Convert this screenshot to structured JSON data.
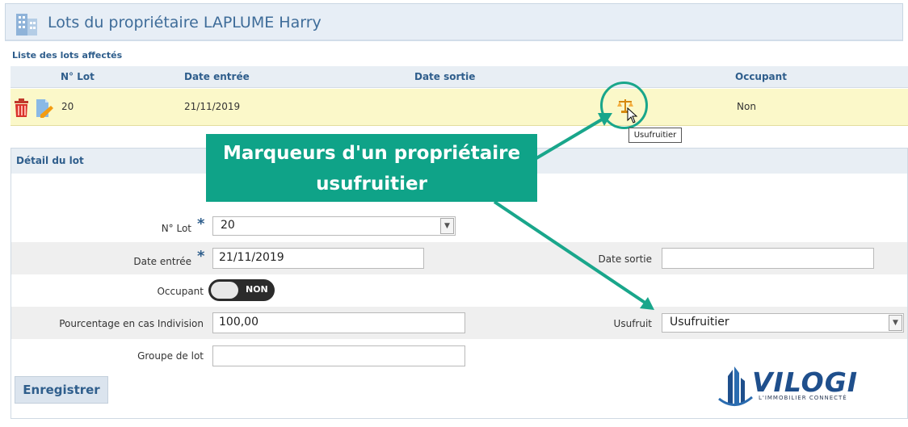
{
  "header": {
    "title": "Lots du propriétaire LAPLUME Harry",
    "icon": "building-icon"
  },
  "list": {
    "title": "Liste des lots affectés",
    "columns": [
      "N° Lot",
      "Date entrée",
      "Date sortie",
      "Occupant"
    ],
    "rows": [
      {
        "lot": "20",
        "date_entree": "21/11/2019",
        "date_sortie": "",
        "occupant": "Non",
        "marker": "scale-icon"
      }
    ],
    "tooltip": "Usufruitier"
  },
  "detail": {
    "title": "Détail du lot",
    "lot_label": "N° Lot",
    "lot_value": "20",
    "date_entree_label": "Date entrée",
    "date_entree_value": "21/11/2019",
    "date_sortie_label": "Date sortie",
    "date_sortie_value": "",
    "occupant_label": "Occupant",
    "occupant_toggle": "NON",
    "pourcentage_label": "Pourcentage en cas Indivision",
    "pourcentage_value": "100,00",
    "usufruit_label": "Usufruit",
    "usufruit_value": "Usufruitier",
    "groupe_label": "Groupe de lot",
    "groupe_value": "",
    "save_label": "Enregistrer",
    "required_mark": "*"
  },
  "callout": {
    "line1": "Marqueurs d'un propriétaire",
    "line2": "usufruitier"
  },
  "logo": {
    "word": "VILOGI",
    "tagline": "L'IMMOBILIER CONNECTÉ"
  },
  "colors": {
    "accent": "#0fa388",
    "title_blue": "#3e6c99",
    "row_highlight": "#fbf8c9"
  }
}
